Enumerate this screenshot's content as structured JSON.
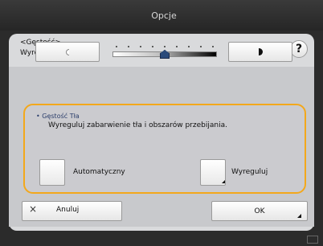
{
  "window": {
    "title": "Opcje"
  },
  "header": {
    "subtitle": "<Gęstość>",
    "description": "Wyreguluj gęstość."
  },
  "help": {
    "label": "?"
  },
  "density": {
    "level_index": 4,
    "steps": 9
  },
  "background": {
    "title": "• Gęstość Tła",
    "description": "Wyreguluj zabarwienie tła i obszarów przebijania.",
    "auto_label": "Automatyczny",
    "adjust_label": "Wyreguluj"
  },
  "footer": {
    "cancel_label": "Anuluj",
    "ok_label": "OK"
  },
  "colors": {
    "accent": "#f3a81b",
    "thumb": "#2a4a7a"
  }
}
